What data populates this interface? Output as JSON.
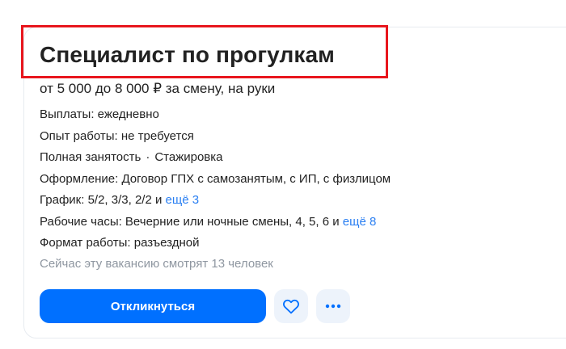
{
  "vacancy": {
    "title": "Специалист по прогулкам",
    "salary": "от 5 000 до 8 000 ₽ за смену, на руки",
    "payments": "Выплаты: ежедневно",
    "experience": "Опыт работы: не требуется",
    "employment": {
      "type": "Полная занятость",
      "separator": "·",
      "extra": "Стажировка"
    },
    "registration": "Оформление: Договор ГПХ с самозанятым, с ИП, с физлицом",
    "schedule": {
      "text": "График: 5/2, 3/3, 2/2 и ",
      "more_link": "ещё 3"
    },
    "hours": {
      "text": "Рабочие часы: Вечерние или ночные смены, 4, 5, 6 и ",
      "more_link": "ещё 8"
    },
    "work_format": "Формат работы: разъездной",
    "viewers": "Сейчас эту вакансию смотрят 13 человек"
  },
  "actions": {
    "respond_label": "Откликнуться",
    "favorite_icon": "heart-icon",
    "more_icon": "more-dots-icon"
  },
  "colors": {
    "primary": "#0070ff",
    "link": "#2a7ff2",
    "highlight_border": "#e8161d",
    "muted_text": "#8f97a1",
    "icon_button_bg": "#edf3fb"
  }
}
